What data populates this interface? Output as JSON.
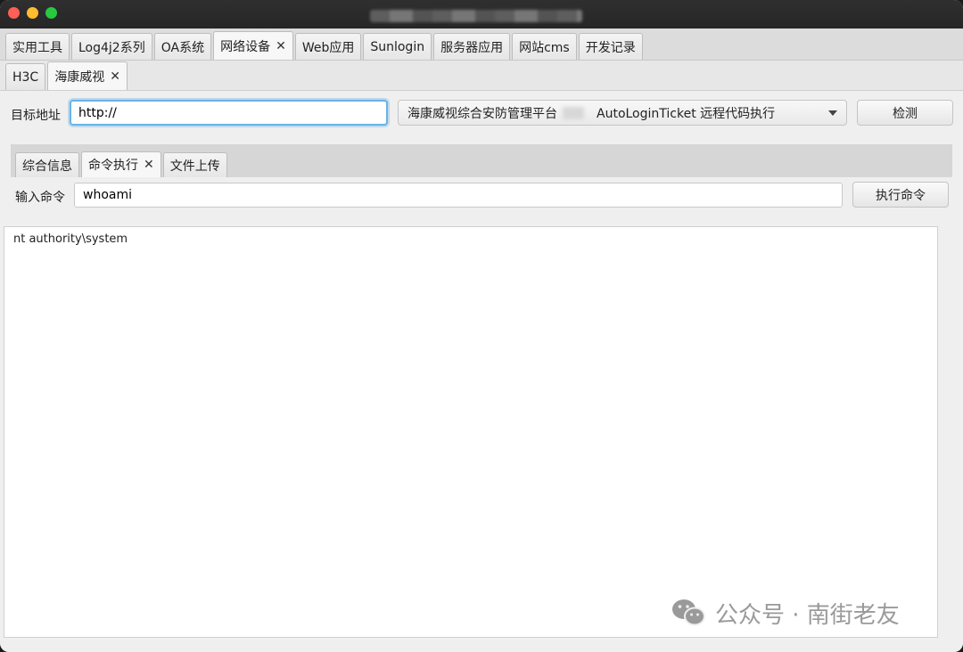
{
  "window": {
    "title_redacted": true
  },
  "top_tabs": [
    {
      "label": "实用工具",
      "active": false,
      "closable": false
    },
    {
      "label": "Log4j2系列",
      "active": false,
      "closable": false
    },
    {
      "label": "OA系统",
      "active": false,
      "closable": false
    },
    {
      "label": "网络设备",
      "active": true,
      "closable": true
    },
    {
      "label": "Web应用",
      "active": false,
      "closable": false
    },
    {
      "label": "Sunlogin",
      "active": false,
      "closable": false
    },
    {
      "label": "服务器应用",
      "active": false,
      "closable": false
    },
    {
      "label": "网站cms",
      "active": false,
      "closable": false
    },
    {
      "label": "开发记录",
      "active": false,
      "closable": false
    }
  ],
  "sub_tabs": [
    {
      "label": "H3C",
      "active": false,
      "closable": false
    },
    {
      "label": "海康威视",
      "active": true,
      "closable": true
    }
  ],
  "target": {
    "label": "目标地址",
    "url_value": "http://"
  },
  "exploit_select": {
    "prefix": "海康威视综合安防管理平台",
    "suffix": "AutoLoginTicket 远程代码执行"
  },
  "detect_button": "检测",
  "inner_tabs": [
    {
      "label": "综合信息",
      "active": false,
      "closable": false
    },
    {
      "label": "命令执行",
      "active": true,
      "closable": true
    },
    {
      "label": "文件上传",
      "active": false,
      "closable": false
    }
  ],
  "command": {
    "label": "输入命令",
    "value": "whoami",
    "exec_button": "执行命令"
  },
  "output": {
    "text": "nt authority\\system"
  },
  "watermark": {
    "text": "公众号 · 南街老友"
  },
  "colors": {
    "focus_ring": "#6ab2e6",
    "window_bg": "#ececec",
    "titlebar": "#2a2a2a"
  }
}
